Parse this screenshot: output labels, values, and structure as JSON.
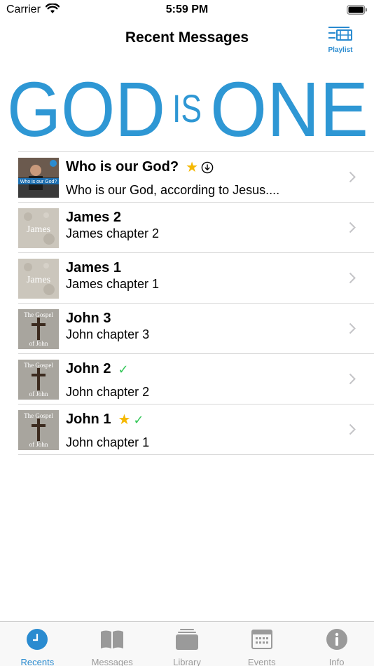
{
  "status_bar": {
    "carrier": "Carrier",
    "time": "5:59 PM"
  },
  "nav": {
    "title": "Recent Messages",
    "playlist_label": "Playlist"
  },
  "banner": {
    "word1": "GOD",
    "word2": "IS",
    "word3": "ONE",
    "color": "#2e97d4"
  },
  "messages": [
    {
      "title": "Who is our God?",
      "subtitle": "Who is our God, according to Jesus....",
      "thumb_text": "Who is our God?",
      "starred": true,
      "downloaded": true,
      "watched": false
    },
    {
      "title": "James 2",
      "subtitle": "James chapter 2",
      "thumb_text": "James",
      "starred": false,
      "downloaded": false,
      "watched": false
    },
    {
      "title": "James 1",
      "subtitle": "James chapter 1",
      "thumb_text": "James",
      "starred": false,
      "downloaded": false,
      "watched": false
    },
    {
      "title": "John 3",
      "subtitle": "John chapter 3",
      "thumb_text_top": "The Gospel",
      "thumb_text_bottom": "of John",
      "starred": false,
      "downloaded": false,
      "watched": false
    },
    {
      "title": "John 2",
      "subtitle": "John chapter 2",
      "thumb_text_top": "The Gospel",
      "thumb_text_bottom": "of John",
      "starred": false,
      "downloaded": false,
      "watched": true
    },
    {
      "title": "John 1",
      "subtitle": "John chapter 1",
      "thumb_text_top": "The Gospel",
      "thumb_text_bottom": "of John",
      "starred": true,
      "downloaded": false,
      "watched": true
    }
  ],
  "tabs": [
    {
      "label": "Recents",
      "icon": "clock-icon",
      "active": true
    },
    {
      "label": "Messages",
      "icon": "book-icon",
      "active": false
    },
    {
      "label": "Library",
      "icon": "stack-icon",
      "active": false
    },
    {
      "label": "Events",
      "icon": "calendar-icon",
      "active": false
    },
    {
      "label": "Info",
      "icon": "info-icon",
      "active": false
    }
  ],
  "colors": {
    "accent": "#2a8bd0",
    "star": "#f5b800",
    "check": "#34c759",
    "inactive_tab": "#9a9a9a"
  }
}
